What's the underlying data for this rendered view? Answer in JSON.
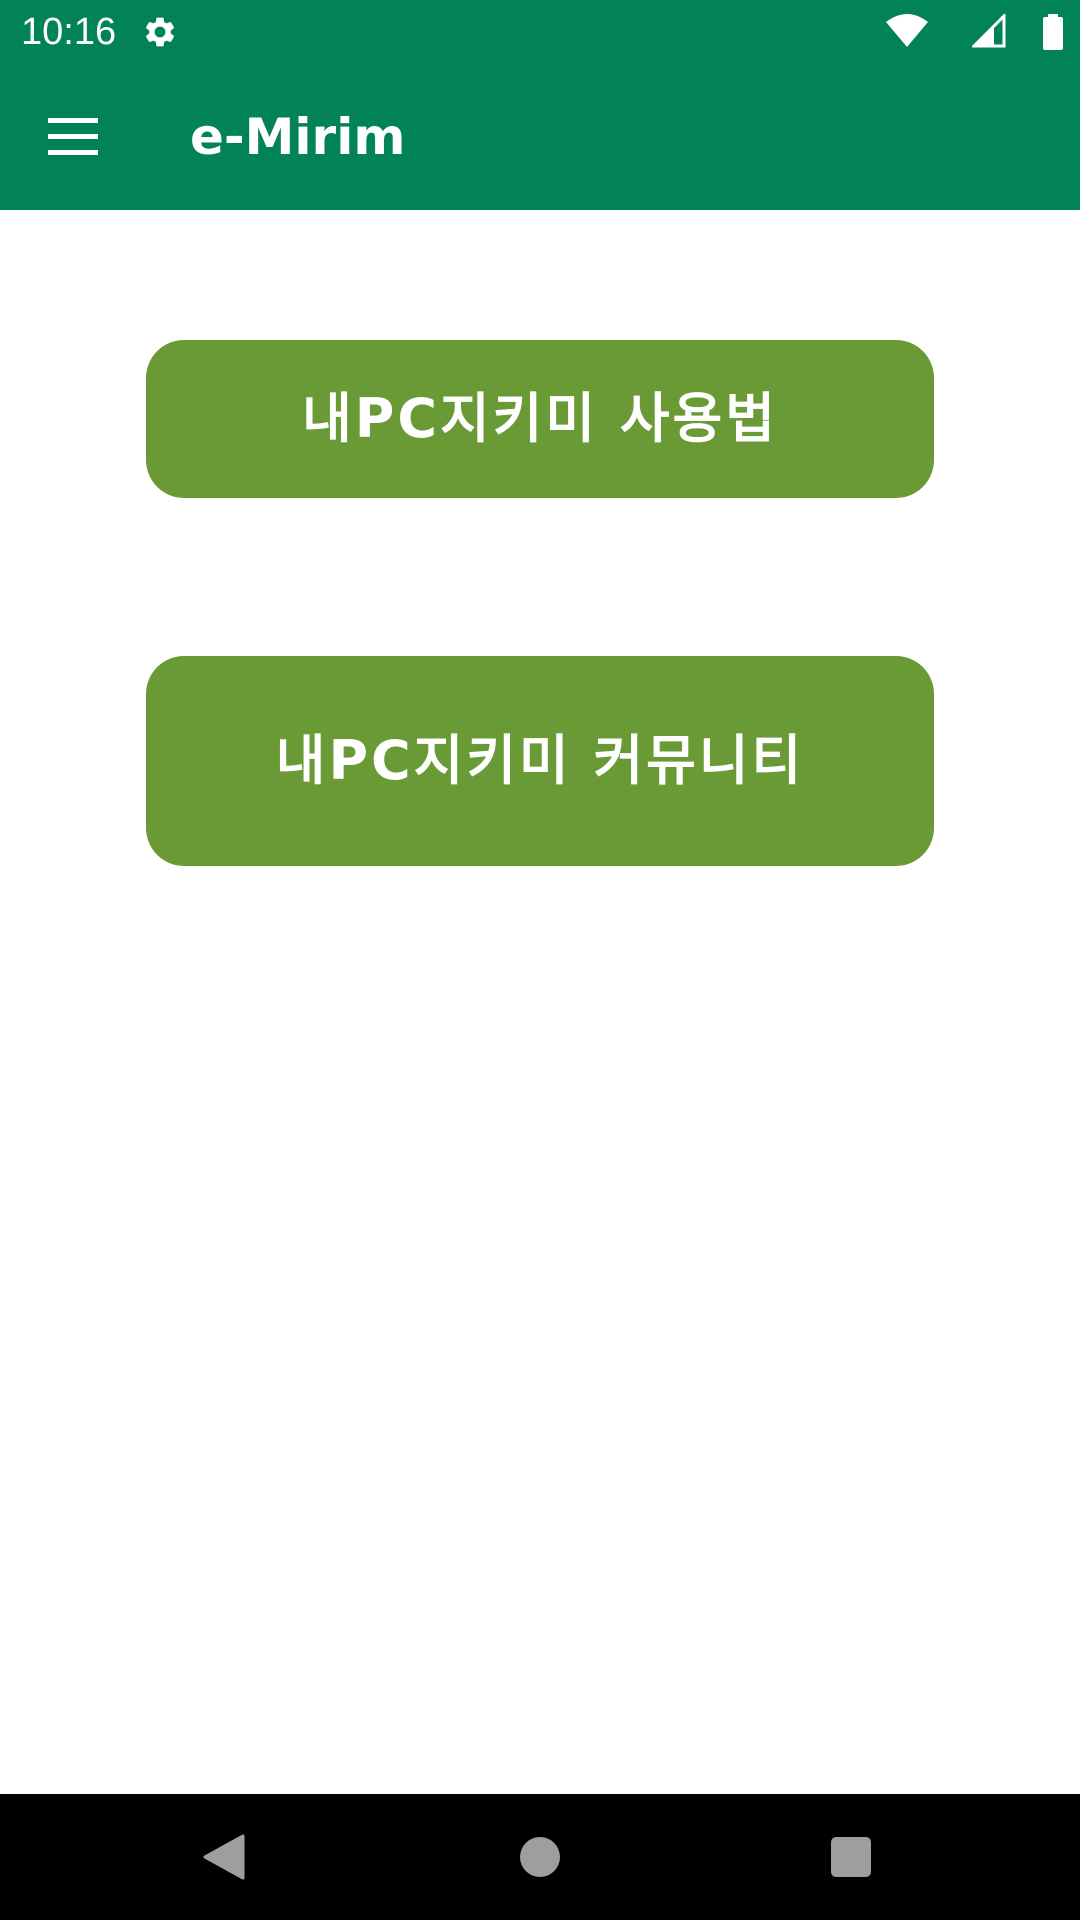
{
  "status_bar": {
    "time": "10:16",
    "icons": [
      "settings-gear-icon",
      "wifi-icon",
      "cellular-signal-icon",
      "battery-icon"
    ]
  },
  "app_bar": {
    "menu_icon": "hamburger-menu-icon",
    "title": "e-Mirim"
  },
  "main": {
    "buttons": [
      {
        "label": "내PC지키미 사용법"
      },
      {
        "label": "내PC지키미 커뮤니티"
      }
    ]
  },
  "nav_bar": {
    "icons": [
      "back-icon",
      "home-icon",
      "recents-icon"
    ]
  },
  "colors": {
    "primary": "#018355",
    "button": "#6a9a36",
    "on_primary": "#ffffff",
    "nav_background": "#000000",
    "nav_icon": "#9e9e9e"
  }
}
